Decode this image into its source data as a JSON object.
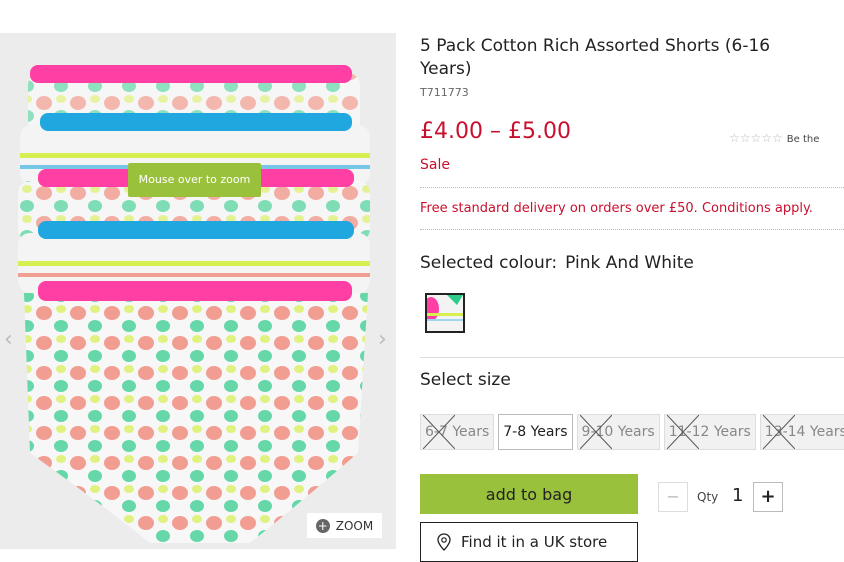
{
  "product": {
    "title": "5 Pack Cotton Rich Assorted Shorts (6-16 Years)",
    "code": "T711773",
    "price": "£4.00 – £5.00",
    "sale": "Sale",
    "rating_stars": "☆☆☆☆☆",
    "rating_text": "Be the",
    "delivery": "Free standard delivery on orders over £50. Conditions apply."
  },
  "gallery": {
    "zoom_tip": "Mouse over to zoom",
    "zoom_label": "ZOOM",
    "prev_icon": "chevron-left-icon",
    "next_icon": "chevron-right-icon"
  },
  "colour": {
    "label": "Selected colour:",
    "value": "Pink And White"
  },
  "size": {
    "label": "Select size",
    "options": [
      {
        "label": "6-7 Years",
        "available": false
      },
      {
        "label": "7-8 Years",
        "available": true
      },
      {
        "label": "9-10 Years",
        "available": false
      },
      {
        "label": "11-12 Years",
        "available": false
      },
      {
        "label": "13-14 Years",
        "available": false
      }
    ]
  },
  "actions": {
    "add_to_bag": "add to bag",
    "qty_label": "Qty",
    "qty_value": "1",
    "minus": "−",
    "plus": "+",
    "find_store": "Find it in a UK store"
  },
  "colors": {
    "accent_green": "#9ac13c",
    "sale_red": "#c8102e",
    "pink": "#ff3fa4",
    "blue": "#21a7e0"
  }
}
